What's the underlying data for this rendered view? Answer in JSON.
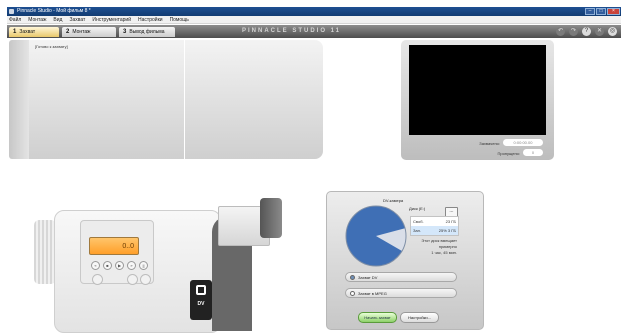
{
  "window": {
    "title": "Pinnacle Studio - Мой фильм 8 *"
  },
  "menu": {
    "items": [
      "Файл",
      "Монтаж",
      "Вид",
      "Захват",
      "Инструментарий",
      "Настройки",
      "Помощь"
    ]
  },
  "tabs": [
    {
      "num": "1",
      "label": "Захват",
      "active": true
    },
    {
      "num": "2",
      "label": "Монтаж",
      "active": false
    },
    {
      "num": "3",
      "label": "Вывод фильма",
      "active": false
    }
  ],
  "brand": "PINNACLE STUDIO 11",
  "album": {
    "caption": "[Готово к захвату]"
  },
  "player": {
    "counter_label": "Захвачено:",
    "counter_value": "0:00:00.00",
    "dropped_label": "Пропущено:",
    "dropped_value": "0"
  },
  "camera": {
    "lcd": "0..0",
    "buttons": [
      "«",
      "■",
      "▶",
      "»",
      "||"
    ],
    "logo": "DV"
  },
  "capture": {
    "title": "DV-камера",
    "disk_label": "Диск (E:)",
    "disk_button": "...",
    "stats": [
      {
        "label": "Своб.",
        "value": "23 ГБ"
      },
      {
        "label": "Зан.",
        "value": "25% 3 ГБ"
      }
    ],
    "estimate_lines": [
      "Этот диск вмещает",
      "примерно",
      "1 час, 45 мин."
    ],
    "options": [
      {
        "label": "Захват DV",
        "selected": true
      },
      {
        "label": "Захват в MPEG",
        "selected": false
      }
    ],
    "start_label": "Начать захват",
    "settings_label": "Настройки..."
  },
  "disk_usage": {
    "used_fraction": 0.25,
    "free_color": "#3f6fb5",
    "used_color": "#d9dee8"
  }
}
